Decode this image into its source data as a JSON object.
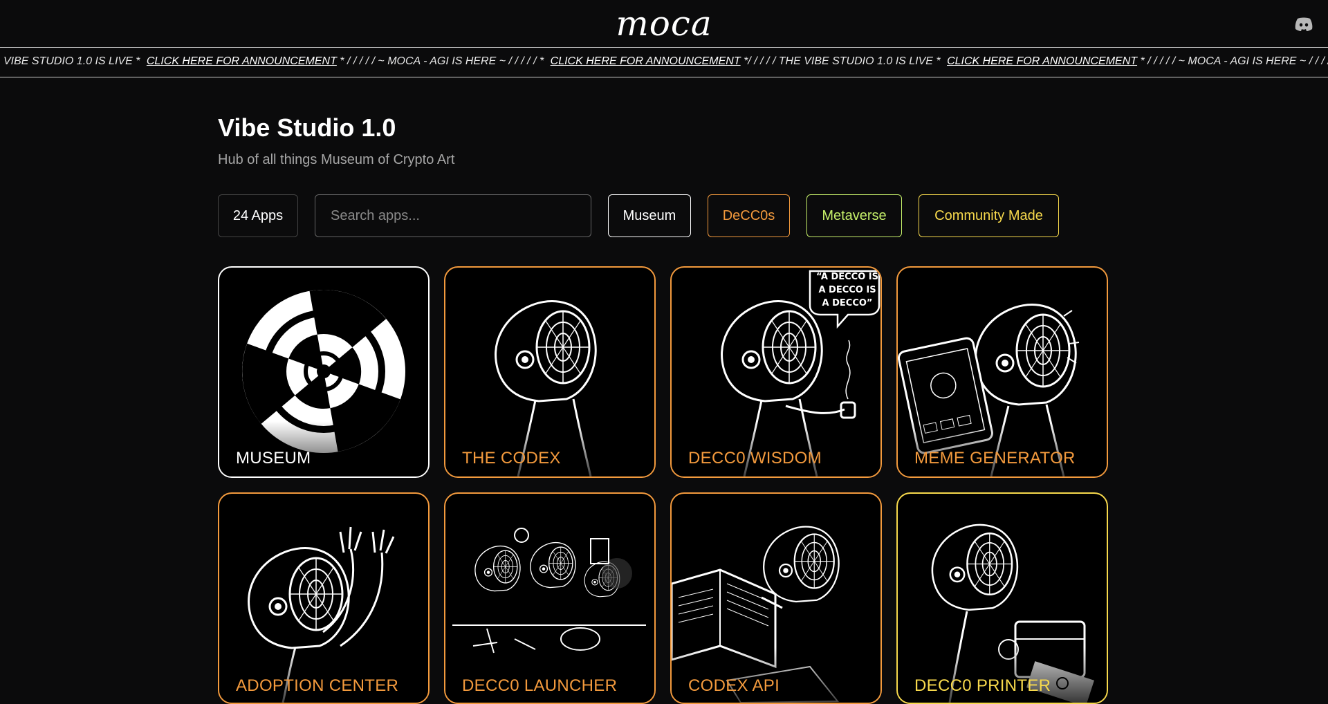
{
  "header": {
    "logo_text": "moca",
    "discord_icon": "discord-icon"
  },
  "ticker": {
    "segments": [
      {
        "text": "VIBE STUDIO 1.0 IS LIVE *",
        "link": false
      },
      {
        "text": "CLICK HERE FOR ANNOUNCEMENT",
        "link": true
      },
      {
        "text": "* / / / / / ~ MOCA - AGI IS HERE ~ / / / / / *",
        "link": false
      },
      {
        "text": "CLICK HERE FOR ANNOUNCEMENT",
        "link": true
      },
      {
        "text": "*/ / / / / THE VIBE STUDIO 1.0 IS LIVE *",
        "link": false
      },
      {
        "text": "CLICK HERE FOR ANNOUNCEMENT",
        "link": true
      },
      {
        "text": "* / / / / / ~ MOCA - AGI IS HERE ~ / / / / /",
        "link": false
      }
    ]
  },
  "page": {
    "title": "Vibe Studio 1.0",
    "subtitle": "Hub of all things Museum of Crypto Art"
  },
  "controls": {
    "count_label": "24 Apps",
    "search_placeholder": "Search apps...",
    "search_value": "",
    "filters": [
      {
        "label": "Museum",
        "color": "#ffffff"
      },
      {
        "label": "DeCC0s",
        "color": "#f39a3d"
      },
      {
        "label": "Metaverse",
        "color": "#c6f06a"
      },
      {
        "label": "Community Made",
        "color": "#f7d94c"
      }
    ]
  },
  "apps": [
    {
      "label": "MUSEUM",
      "color": "#ffffff"
    },
    {
      "label": "THE CODEX",
      "color": "#f39a3d"
    },
    {
      "label": "DECC0 WISDOM",
      "color": "#f39a3d",
      "bubble": [
        "“A DECCO IS",
        "A DECCO IS",
        "A DECCO”"
      ]
    },
    {
      "label": "MEME GENERATOR",
      "color": "#f39a3d"
    },
    {
      "label": "ADOPTION CENTER",
      "color": "#f39a3d"
    },
    {
      "label": "DECC0 LAUNCHER",
      "color": "#f39a3d"
    },
    {
      "label": "CODEX API",
      "color": "#f39a3d"
    },
    {
      "label": "DECC0 PRINTER",
      "color": "#f7d94c"
    }
  ]
}
